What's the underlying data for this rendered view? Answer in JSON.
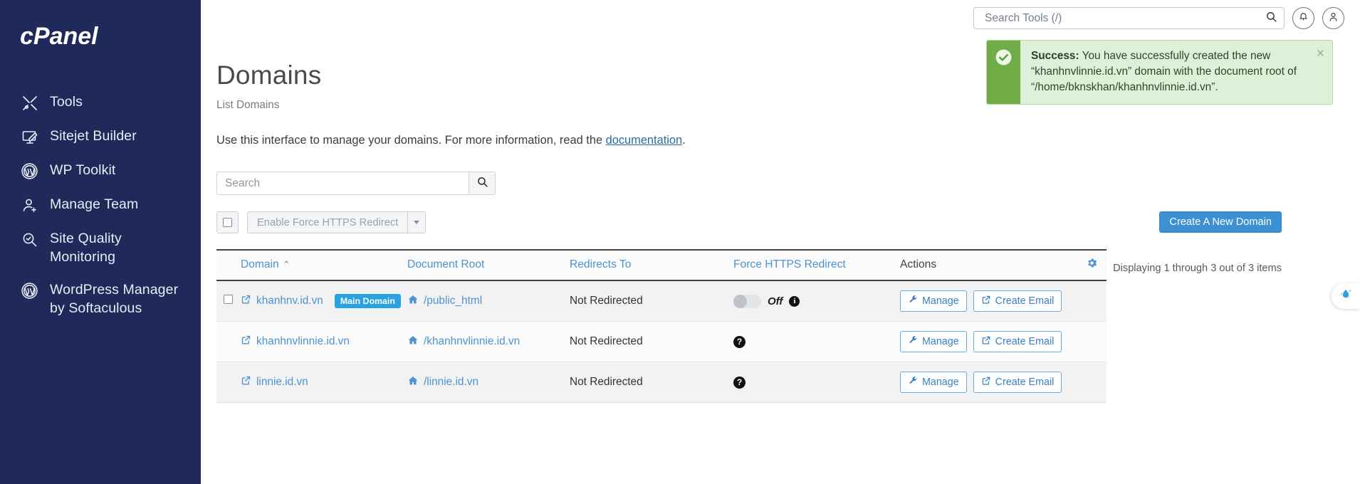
{
  "sidebar": {
    "brand": "cPanel",
    "items": [
      {
        "label": "Tools",
        "icon": "tools-icon"
      },
      {
        "label": "Sitejet Builder",
        "icon": "monitor-pen-icon"
      },
      {
        "label": "WP Toolkit",
        "icon": "wordpress-icon"
      },
      {
        "label": "Manage Team",
        "icon": "user-plus-icon"
      },
      {
        "label": "Site Quality Monitoring",
        "icon": "magnifier-check-icon"
      },
      {
        "label": "WordPress Manager by Softaculous",
        "icon": "wordpress-icon"
      }
    ]
  },
  "topbar": {
    "search_placeholder": "Search Tools (/)",
    "search_value": "",
    "notifications_icon": "bell-icon",
    "account_icon": "user-icon",
    "search_icon": "search-icon"
  },
  "alert": {
    "status_icon": "check-circle-icon",
    "strong": "Success:",
    "message": " You have successfully created the new “khanhnvlinnie.id.vn” domain with the document root of “/home/bknskhan/khanhnvlinnie.id.vn”.",
    "close_label": "×",
    "accent_color": "#70ad47",
    "background_color": "#dff0d8"
  },
  "page": {
    "title": "Domains",
    "breadcrumb": "List Domains",
    "intro_prefix": "Use this interface to manage your domains. For more information, read the ",
    "intro_link": "documentation",
    "intro_suffix": "."
  },
  "search": {
    "placeholder": "Search",
    "value": "",
    "button_icon": "search-icon"
  },
  "toolbar": {
    "select_all_label": "select-all-checkbox",
    "bulk_action_label": "Enable Force HTTPS Redirect",
    "bulk_caret_icon": "chevron-down-icon",
    "create_label": "Create A New Domain",
    "count_text": "Displaying 1 through 3 out of 3 items",
    "accent_color": "#3c91d4"
  },
  "table": {
    "columns": [
      "Domain",
      "Document Root",
      "Redirects To",
      "Force HTTPS Redirect",
      "Actions"
    ],
    "sort_column": "Domain",
    "sort_direction": "asc",
    "sort_caret": "⌃",
    "settings_icon": "gear-icon",
    "rows": [
      {
        "has_checkbox": true,
        "domain": "khanhnv.id.vn",
        "badge": "Main Domain",
        "document_root": "/public_html",
        "redirects_to": "Not Redirected",
        "https_mode": "toggle",
        "https_state": "Off",
        "https_hint_icon": "info-icon",
        "manage_label": "Manage",
        "create_email_label": "Create Email"
      },
      {
        "has_checkbox": false,
        "domain": "khanhnvlinnie.id.vn",
        "badge": "",
        "document_root": "/khanhnvlinnie.id.vn",
        "redirects_to": "Not Redirected",
        "https_mode": "help",
        "https_state": "",
        "https_hint_icon": "question-icon",
        "manage_label": "Manage",
        "create_email_label": "Create Email"
      },
      {
        "has_checkbox": false,
        "domain": "linnie.id.vn",
        "badge": "",
        "document_root": "/linnie.id.vn",
        "redirects_to": "Not Redirected",
        "https_mode": "help",
        "https_state": "",
        "https_hint_icon": "question-icon",
        "manage_label": "Manage",
        "create_email_label": "Create Email"
      }
    ]
  },
  "float_widget": {
    "icon": "water-drop-sparkle-icon",
    "color": "#29a3e0"
  }
}
